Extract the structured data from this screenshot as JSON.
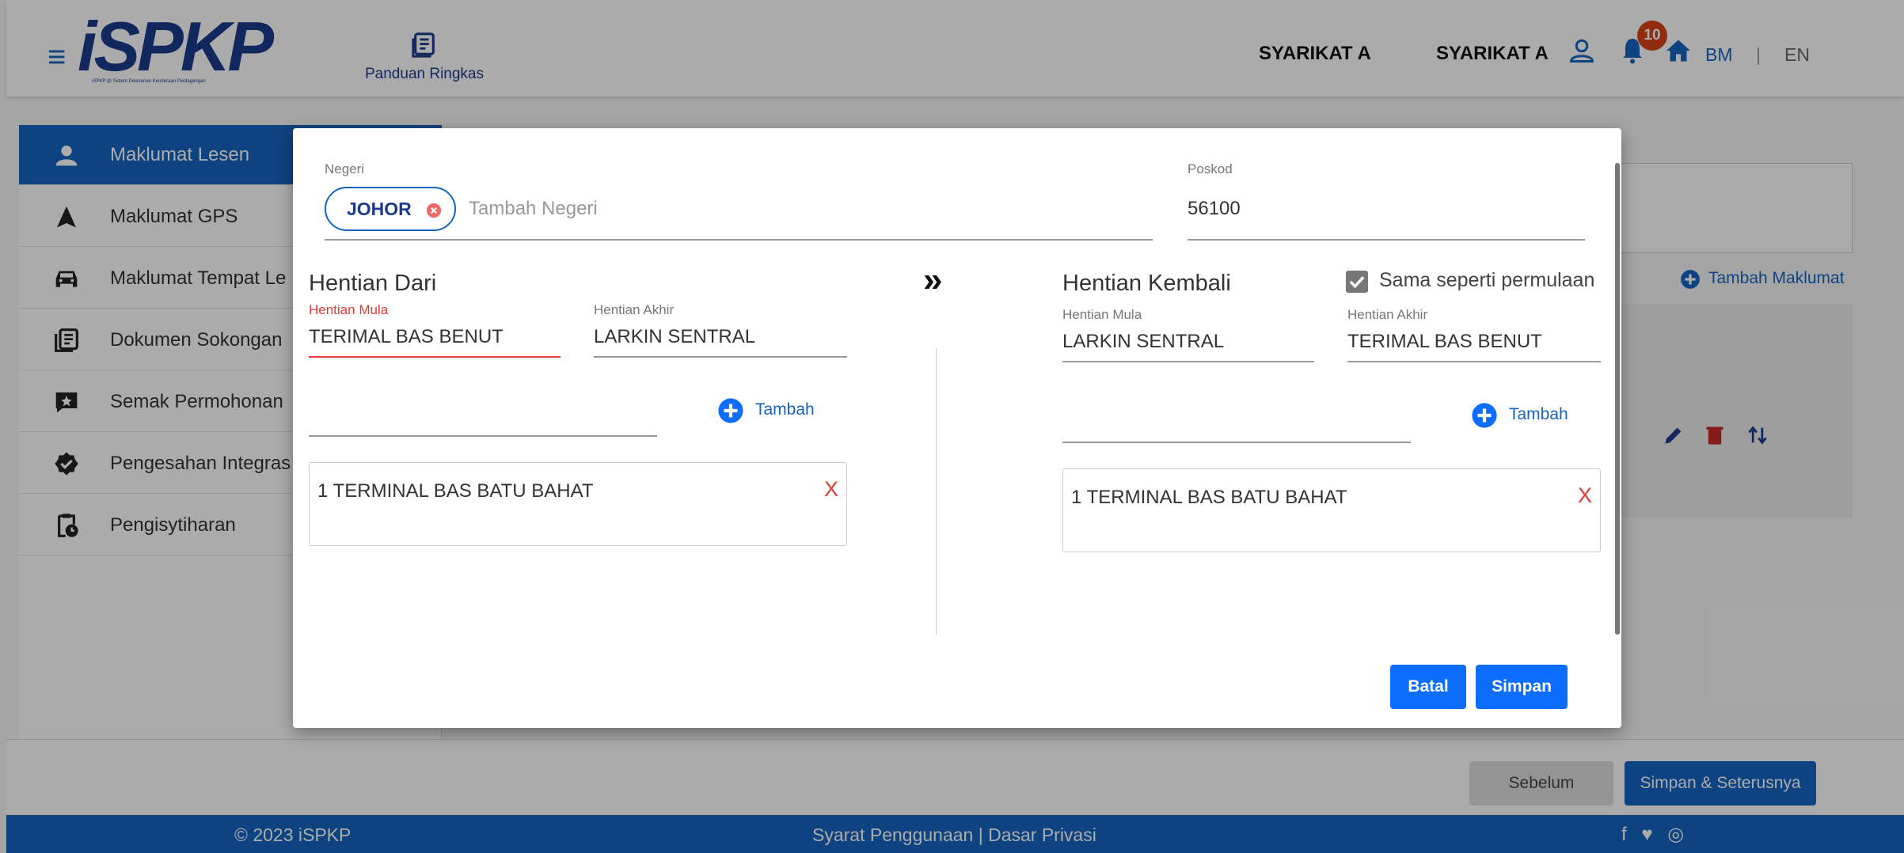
{
  "header": {
    "logo_text": "iSPKP",
    "logo_tagline": "iSPKP @ Sistem Pelesenan Kenderaan Perdagangan",
    "guide_label": "Panduan Ringkas",
    "company_1": "SYARIKAT A",
    "company_2": "SYARIKAT A",
    "notification_count": "10",
    "lang_bm": "BM",
    "lang_sep": "|",
    "lang_en": "EN"
  },
  "sidebar": {
    "items": [
      {
        "label": "Maklumat Lesen",
        "icon": "user-icon"
      },
      {
        "label": "Maklumat GPS",
        "icon": "navigation-icon"
      },
      {
        "label": "Maklumat Tempat Le",
        "icon": "car-icon"
      },
      {
        "label": "Dokumen Sokongan",
        "icon": "documents-icon"
      },
      {
        "label": "Semak Permohonan",
        "icon": "review-icon"
      },
      {
        "label": "Pengesahan Integras",
        "icon": "verified-icon"
      },
      {
        "label": "Pengisytiharan",
        "icon": "clipboard-clock-icon"
      }
    ]
  },
  "main": {
    "add_info_label": "Tambah Maklumat"
  },
  "modal": {
    "negeri_label": "Negeri",
    "negeri_chip": "JOHOR",
    "negeri_placeholder": "Tambah Negeri",
    "poskod_label": "Poskod",
    "poskod_value": "56100",
    "left": {
      "title": "Hentian Dari",
      "start_label": "Hentian Mula",
      "start_value": "TERIMAL BAS BENUT",
      "end_label": "Hentian Akhir",
      "end_value": "LARKIN SENTRAL",
      "add_label": "Tambah",
      "stop_value": "1 TERMINAL BAS BATU BAHAT",
      "remove_label": "X"
    },
    "right": {
      "title": "Hentian Kembali",
      "same_label": "Sama seperti permulaan",
      "same_checked": true,
      "start_label": "Hentian Mula",
      "start_value": "LARKIN SENTRAL",
      "end_label": "Hentian Akhir",
      "end_value": "TERIMAL BAS BENUT",
      "add_label": "Tambah",
      "stop_value": "1 TERMINAL BAS BATU BAHAT",
      "remove_label": "X"
    },
    "arrow": "»",
    "cancel_label": "Batal",
    "save_label": "Simpan"
  },
  "nav": {
    "prev_label": "Sebelum",
    "next_label": "Simpan & Seterusnya"
  },
  "footer": {
    "copyright": "© 2023 iSPKP",
    "terms": "Syarat Penggunaan | Dasar Privasi",
    "social": "f ♥ ◎"
  },
  "colors": {
    "primary": "#1565c0",
    "brand": "#1c3b8c",
    "danger": "#e53935",
    "button": "#0d6efd"
  }
}
